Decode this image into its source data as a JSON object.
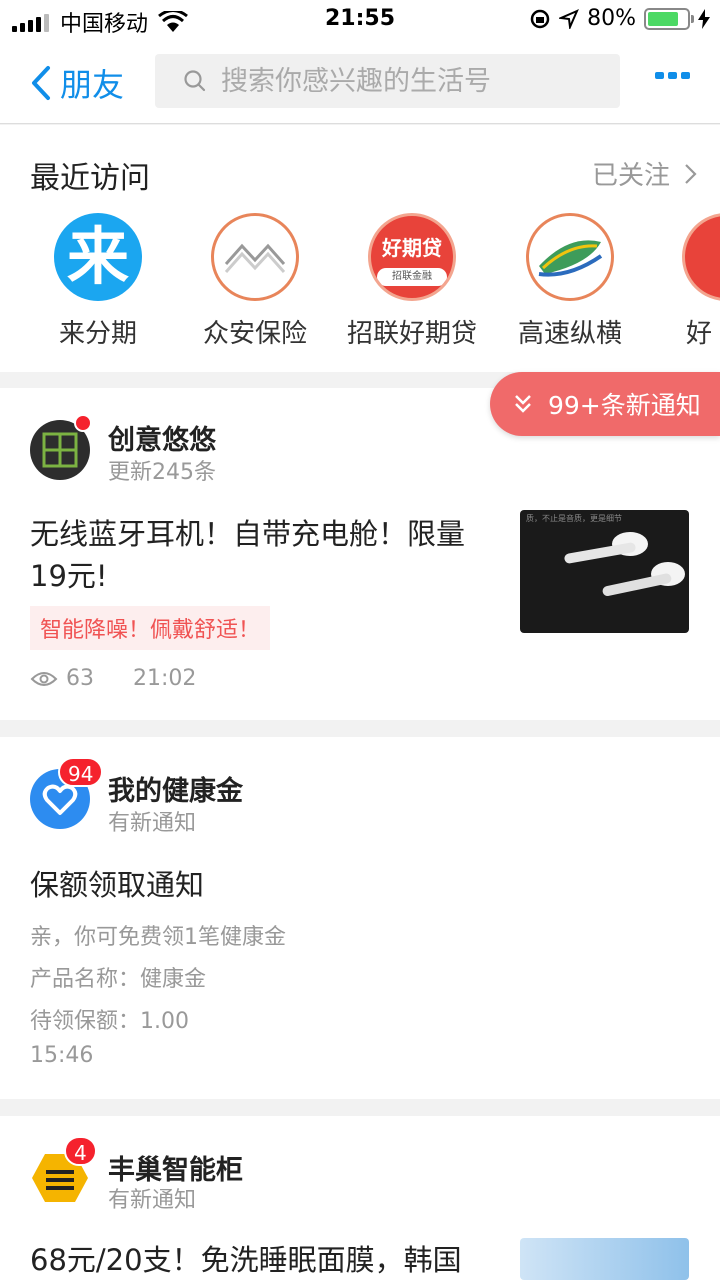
{
  "status_bar": {
    "carrier": "中国移动",
    "time": "21:55",
    "battery": "80%",
    "battery_level": 0.8
  },
  "nav": {
    "back_label": "朋友",
    "search_placeholder": "搜索你感兴趣的生活号"
  },
  "recent": {
    "title": "最近访问",
    "follow_label": "已关注",
    "items": [
      {
        "label": "来分期",
        "logo_text": "来",
        "icon": "laifenqi-logo-icon"
      },
      {
        "label": "众安保险",
        "icon": "zhongan-logo-icon"
      },
      {
        "label": "招联好期贷",
        "logo_text": "好期贷",
        "logo_sub": "招联金融",
        "icon": "haoqidai-logo-icon"
      },
      {
        "label": "高速纵横",
        "icon": "gaosu-logo-icon"
      },
      {
        "label": "好",
        "icon": "partial-logo-icon"
      }
    ]
  },
  "notify_pill": "99+条新通知",
  "cards": [
    {
      "name": "创意悠悠",
      "sub": "更新245条",
      "headline_1": "无线蓝牙耳机！自带充电舱！限量",
      "headline_2": "19元!",
      "tag": "智能降噪！佩戴舒适！",
      "views": "63",
      "time": "21:02",
      "thumb_caption": "质，不止是音质，更是细节"
    },
    {
      "name": "我的健康金",
      "badge": "94",
      "sub": "有新通知",
      "headline": "保额领取通知",
      "line_1": "亲，你可免费领1笔健康金",
      "line_2": "产品名称：健康金",
      "line_3": "待领保额：1.00",
      "time": "15:46"
    },
    {
      "name": "丰巢智能柜",
      "badge": "4",
      "sub": "有新通知",
      "headline": "68元/20支！免洗睡眠面膜，韩国"
    }
  ],
  "colors": {
    "accent": "#108ee9",
    "notify": "#f06a6a",
    "badge": "#f5222d"
  }
}
